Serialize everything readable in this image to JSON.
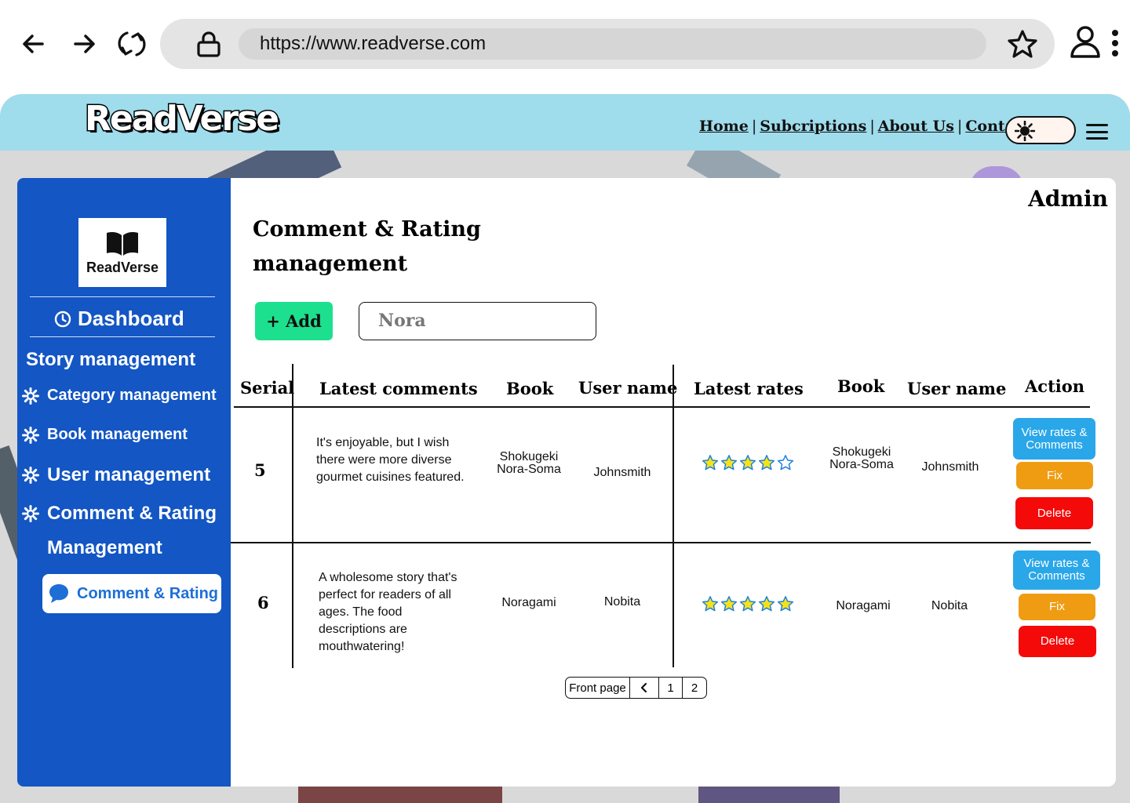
{
  "browser": {
    "url": "https://www.readverse.com"
  },
  "header": {
    "logo": "ReadVerse",
    "links": [
      "Home",
      "Subcriptions",
      "About Us",
      "Contact Us"
    ],
    "separator": "|"
  },
  "sidebar": {
    "logo_name": "ReadVerse",
    "dashboard": "Dashboard",
    "section": "Story management",
    "items": [
      {
        "label": "Category management"
      },
      {
        "label": "Book management"
      },
      {
        "label": "User management"
      },
      {
        "label": "Comment & Rating"
      }
    ],
    "item_line2": "Management",
    "active": "Comment & Rating"
  },
  "main": {
    "admin": "Admin",
    "title": "Comment & Rating management",
    "add_label": "+ Add",
    "search_value": "Nora",
    "columns": [
      "Serial",
      "Latest comments",
      "Book",
      "User name",
      "Latest rates",
      "Book",
      "User name",
      "Action"
    ],
    "rows": [
      {
        "serial": "5",
        "comment": "It's enjoyable, but I wish there were more diverse gourmet cuisines featured.",
        "book": "Shokugeki Nora-Soma",
        "user": "Johnsmith",
        "stars": 4,
        "rate_book": "Shokugeki Nora-Soma",
        "rate_user": "Johnsmith"
      },
      {
        "serial": "6",
        "comment": "A wholesome story that's perfect for readers of all ages. The food descriptions are mouthwatering!",
        "book": "Noragami",
        "user": "Nobita",
        "stars": 5,
        "rate_book": "Noragami",
        "rate_user": "Nobita"
      }
    ],
    "actions": {
      "view": "View rates & Comments",
      "fix": "Fix",
      "delete": "Delete"
    },
    "pager": {
      "front": "Front page",
      "pages": [
        "1",
        "2"
      ]
    }
  },
  "colors": {
    "header_bg": "#9fdcec",
    "sidebar_bg": "#1356c4",
    "add_btn": "#1de08e",
    "view_btn": "#2aa7e8",
    "fix_btn": "#ef9c13",
    "delete_btn": "#f50a0a"
  }
}
